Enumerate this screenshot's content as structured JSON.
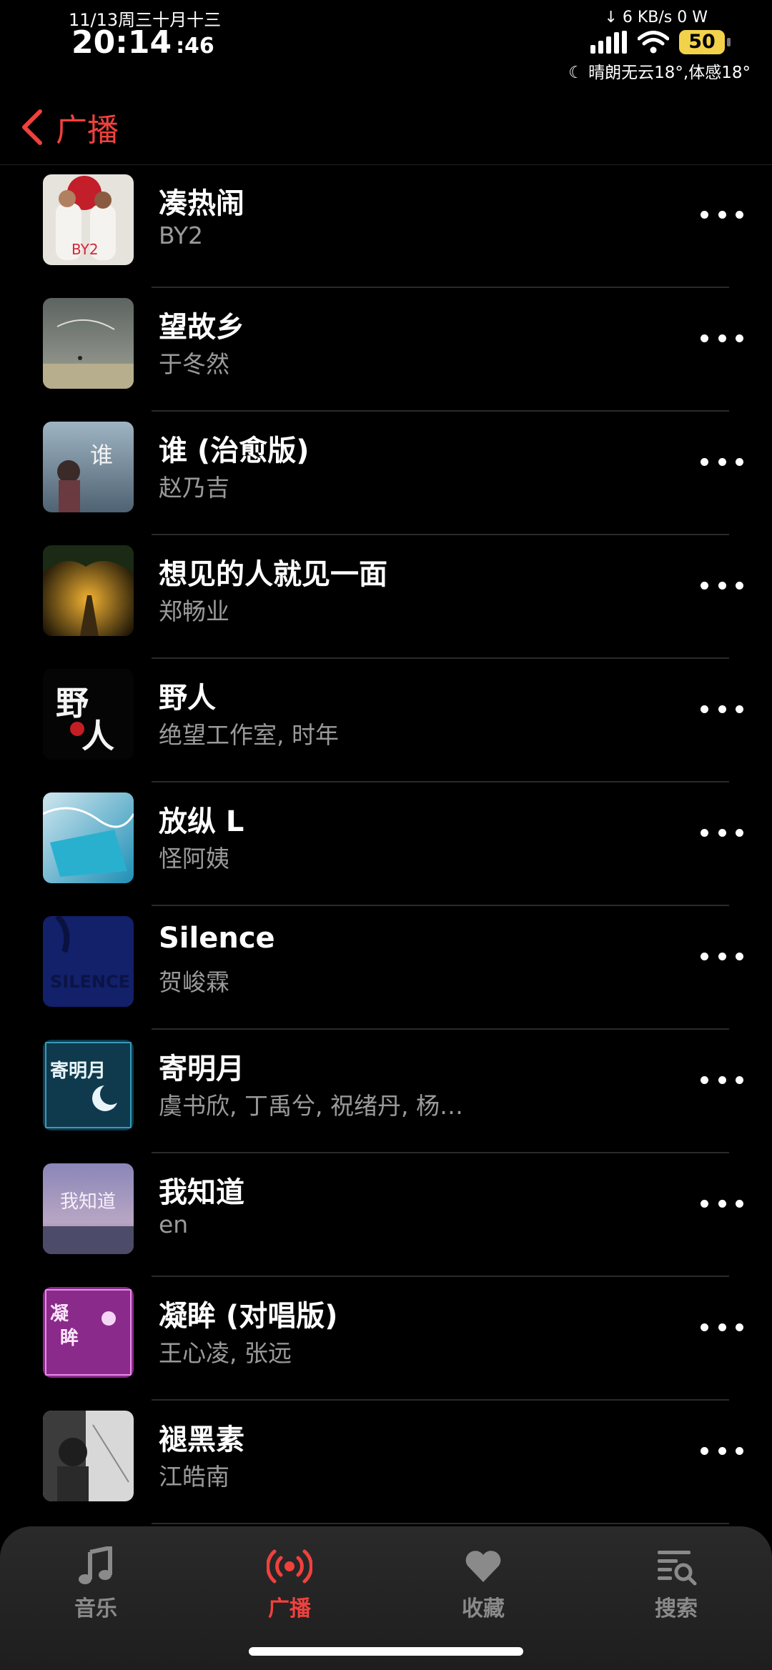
{
  "status_bar": {
    "date": "11/13周三十月十三",
    "time": "20:14",
    "seconds": ":46",
    "network": "↓ 6 KB/s  0 W",
    "battery": "50",
    "weather": "晴朗无云18°,体感18°"
  },
  "nav": {
    "back_label": "广播"
  },
  "songs": [
    {
      "title": "凑热闹",
      "artist": "BY2"
    },
    {
      "title": "望故乡",
      "artist": "于冬然"
    },
    {
      "title": "谁 (治愈版)",
      "artist": "赵乃吉"
    },
    {
      "title": "想见的人就见一面",
      "artist": "郑畅业"
    },
    {
      "title": "野人",
      "artist": "绝望工作室, 时年"
    },
    {
      "title": "放纵 L",
      "artist": "怪阿姨"
    },
    {
      "title": "Silence",
      "artist": "贺峻霖"
    },
    {
      "title": "寄明月",
      "artist": "虞书欣, 丁禹兮, 祝绪丹, 杨…"
    },
    {
      "title": "我知道",
      "artist": "en"
    },
    {
      "title": "凝眸 (对唱版)",
      "artist": "王心凌, 张远"
    },
    {
      "title": "褪黑素",
      "artist": "江皓南"
    }
  ],
  "tabs": [
    {
      "label": "音乐",
      "icon": "music-note-icon"
    },
    {
      "label": "广播",
      "icon": "broadcast-icon"
    },
    {
      "label": "收藏",
      "icon": "heart-icon"
    },
    {
      "label": "搜索",
      "icon": "search-list-icon"
    }
  ],
  "colors": {
    "accent": "#f0413d",
    "background": "#000000",
    "secondary_text": "#9a9a9a"
  }
}
